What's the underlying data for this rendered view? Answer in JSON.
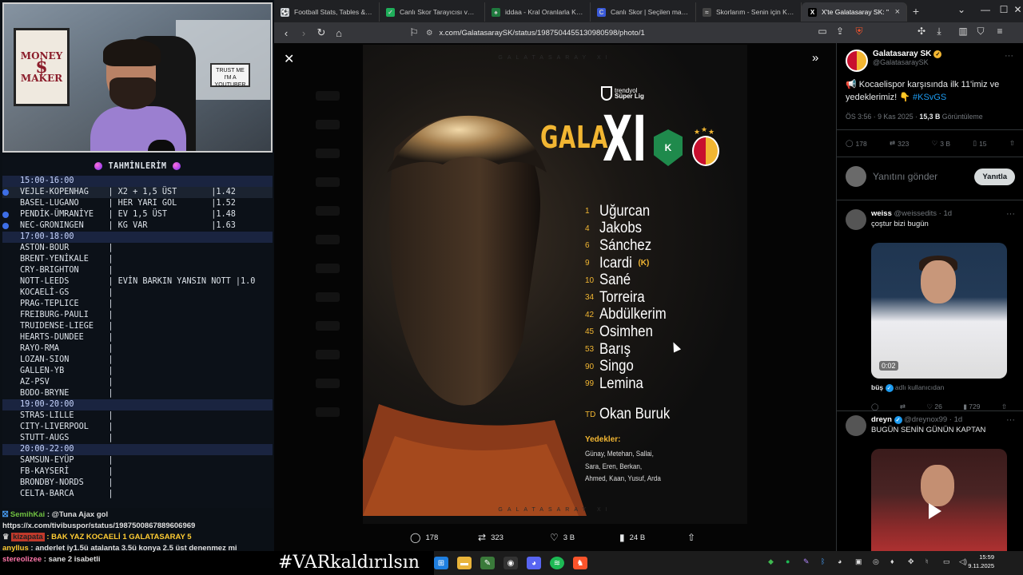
{
  "predictions": {
    "title": "TAHMİNLERİM",
    "rows": [
      {
        "type": "time",
        "text": "15:00-16:00"
      },
      {
        "type": "match",
        "text": "VEJLE-KOPENHAG    | X2 + 1,5 ÜST       |1.42",
        "dot": true,
        "highlight": true
      },
      {
        "type": "match",
        "text": "BASEL-LUGANO      | HER YARI GOL       |1.52"
      },
      {
        "type": "match",
        "text": "PENDİK-ÜMRANİYE   | EV 1,5 ÜST         |1.48",
        "dot": true
      },
      {
        "type": "match",
        "text": "NEC-GRONINGEN     | KG VAR             |1.63",
        "dot": true
      },
      {
        "type": "time",
        "text": "17:00-18:00"
      },
      {
        "type": "match",
        "text": "ASTON-BOUR        |"
      },
      {
        "type": "match",
        "text": "BRENT-YENİKALE    |"
      },
      {
        "type": "match",
        "text": "CRY-BRIGHTON      |"
      },
      {
        "type": "match",
        "text": "NOTT-LEEDS        | EVİN BARKIN YANSIN NOTT |1.0"
      },
      {
        "type": "match",
        "text": "KOCAELİ-GS        |"
      },
      {
        "type": "match",
        "text": "PRAG-TEPLICE      |"
      },
      {
        "type": "match",
        "text": "FREIBURG-PAULI    |"
      },
      {
        "type": "match",
        "text": "TRUIDENSE-LIEGE   |"
      },
      {
        "type": "match",
        "text": "HEARTS-DUNDEE     |"
      },
      {
        "type": "match",
        "text": "RAYO-RMA          |"
      },
      {
        "type": "match",
        "text": "LOZAN-SION        |"
      },
      {
        "type": "match",
        "text": "GALLEN-YB         |"
      },
      {
        "type": "match",
        "text": "AZ-PSV            |"
      },
      {
        "type": "match",
        "text": "BODO-BRYNE        |"
      },
      {
        "type": "time",
        "text": "19:00-20:00"
      },
      {
        "type": "match",
        "text": "STRAS-LILLE       |"
      },
      {
        "type": "match",
        "text": "CITY-LIVERPOOL    |"
      },
      {
        "type": "match",
        "text": "STUTT-AUGS        |"
      },
      {
        "type": "time",
        "text": "20:00-22:00"
      },
      {
        "type": "match",
        "text": "SAMSUN-EYÜP       |"
      },
      {
        "type": "match",
        "text": "FB-KAYSERİ        |"
      },
      {
        "type": "match",
        "text": "BRONDBY-NORDS     |"
      },
      {
        "type": "match",
        "text": "CELTA-BARCA       |"
      }
    ]
  },
  "webcam": {
    "poster_lines": [
      "MONEY",
      "MAKER"
    ],
    "sign_lines": [
      "TRUST ME",
      "I'M A YOUTUBER"
    ]
  },
  "chat": {
    "line1_name": "SemihKai",
    "line1_text": ": @Tuna Ajax gol",
    "line2_text": "https://x.com/tivibuspor/status/1987500867889606969",
    "line3_name": "kizapata",
    "line3_text": ": BAK YAZ KOCAELİ 1 GALATASARAY 5",
    "line4_name": "anyllus",
    "line4_text": " : anderlet iy1.5ü atalanta 3.5ü konya 2.5 üst denenmez mi",
    "line5_name": "stereolizee",
    "line5_text": " : sane 2 isabetli"
  },
  "overlay_text": "#VARkaldırılsın",
  "tabs": [
    {
      "title": "Football Stats, Tables & Data",
      "icon": "⚽",
      "color": "#cfd3d8"
    },
    {
      "title": "Canlı Skor Tarayıcısı ve Canlı",
      "icon": "✓",
      "color": "#1fae5a"
    },
    {
      "title": "iddaa - Kral Oranlarla Kralla",
      "icon": "♠",
      "color": "#1f7a3e"
    },
    {
      "title": "Canlı Skor | Seçilen maçlar iç",
      "icon": "C",
      "color": "#3a5ad9"
    },
    {
      "title": "Skorlarım - Senin için Kişisel",
      "icon": "≈",
      "color": "#444"
    },
    {
      "title": "X'te Galatasaray SK: \"",
      "icon": "X",
      "color": "#000",
      "active": true
    }
  ],
  "url": "x.com/GalatasaraySK/status/1987504455130980598/photo/1",
  "poster": {
    "watermark": "GALATASARAY XI",
    "league_line1": "trendyol",
    "league_line2": "Süper Lig",
    "title_left": "GALA",
    "title_right": "XI",
    "home_crest_letter": "K",
    "players": [
      {
        "num": "1",
        "name": "Uğurcan"
      },
      {
        "num": "4",
        "name": "Jakobs"
      },
      {
        "num": "6",
        "name": "Sánchez"
      },
      {
        "num": "9",
        "name": "Icardi",
        "captain": "(K)"
      },
      {
        "num": "10",
        "name": "Sané"
      },
      {
        "num": "34",
        "name": "Torreira"
      },
      {
        "num": "42",
        "name": "Abdülkerim"
      },
      {
        "num": "45",
        "name": "Osimhen"
      },
      {
        "num": "53",
        "name": "Barış"
      },
      {
        "num": "90",
        "name": "Singo"
      },
      {
        "num": "99",
        "name": "Lemina"
      }
    ],
    "coach_num": "TD",
    "coach_name": "Okan Buruk",
    "subs_label": "Yedekler:",
    "subs_lines": [
      "Günay, Metehan, Sallai,",
      "Sara, Eren, Berkan,",
      "Ahmed, Kaan, Yusuf, Arda"
    ]
  },
  "viewer_stats": {
    "replies": "178",
    "reposts": "323",
    "likes": "3 B",
    "views": "24 B"
  },
  "tweet": {
    "author": "Galatasaray SK",
    "handle": "@GalatasaraySK",
    "text_main": "📢 Kocaelispor karşısında ilk 11'imiz ve yedeklerimiz! 👇 ",
    "hashtag": "#KSvGS",
    "time": "ÖS 3:56 · 9 Kas 2025 · ",
    "views": "15,3 B",
    "views_label": " Görüntüleme",
    "replies": "178",
    "reposts": "323",
    "likes": "3 B",
    "bookmarks": "15",
    "reply_placeholder": "Yanıtını gönder",
    "reply_button": "Yanıtla"
  },
  "replies": [
    {
      "name": "weiss",
      "handle": "@weissedits · 1d",
      "text": "çoştur bizi bugün",
      "video_time": "0:02",
      "source_name": "büş",
      "source_label": "adlı kullanıcıdan",
      "likes": "26",
      "views": "729"
    },
    {
      "name": "dreyn",
      "handle": "@dreynox99 · 1d",
      "text": "BUGÜN SENİN GÜNÜN KAPTAN"
    }
  ],
  "clock": {
    "time": "15:59",
    "date": "9.11.2025"
  }
}
